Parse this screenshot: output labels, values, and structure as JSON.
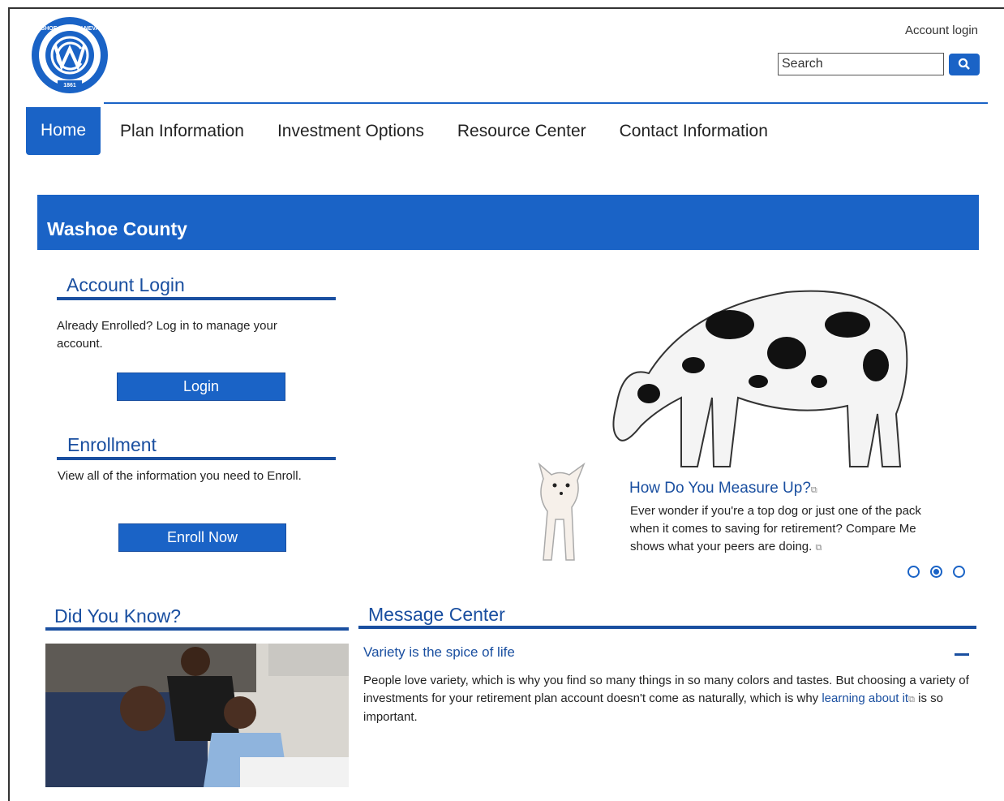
{
  "header": {
    "account_login": "Account login",
    "search_placeholder": "Search",
    "logo_text": "WASHOE COUNTY NEVADA",
    "logo_year": "1861",
    "colors": {
      "brand_blue": "#1a63c6",
      "heading_blue": "#1a4fa0"
    }
  },
  "nav": {
    "items": [
      {
        "label": "Home"
      },
      {
        "label": "Plan Information"
      },
      {
        "label": "Investment Options"
      },
      {
        "label": "Resource Center"
      },
      {
        "label": "Contact Information"
      }
    ]
  },
  "banner": {
    "title": "Washoe County"
  },
  "account_login": {
    "title": "Account Login",
    "text": "Already Enrolled? Log in to manage your account.",
    "button": "Login"
  },
  "enrollment": {
    "title": "Enrollment",
    "text": "View all of the information you need to Enroll.",
    "button": "Enroll Now"
  },
  "promo": {
    "title": "How Do You Measure Up?",
    "text": "Ever wonder if you're a top dog or just one of the pack when it comes to saving for retirement? Compare Me shows what your peers are doing."
  },
  "did_you_know": {
    "title": "Did You Know?"
  },
  "message_center": {
    "title": "Message Center",
    "subtitle": "Variety is the spice of life",
    "text_before": "People love variety, which is why you find so many things in so many colors and tastes. But choosing a variety of investments for your retirement plan account doesn't come as naturally, which is why ",
    "link": "learning about it",
    "text_after": "  is so important."
  }
}
